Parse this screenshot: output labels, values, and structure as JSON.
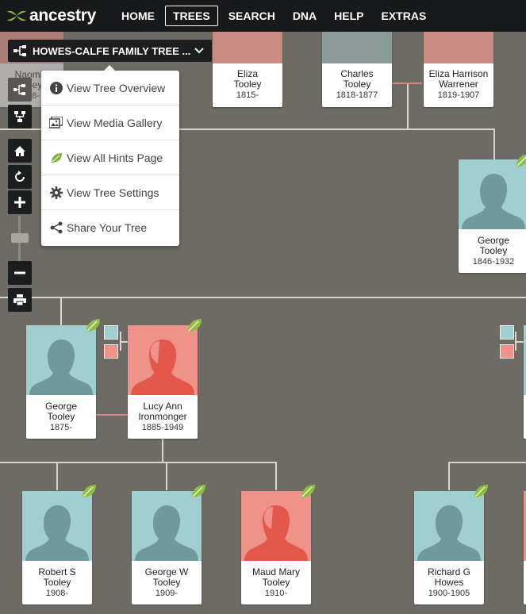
{
  "brand": {
    "name": "ancestry",
    "logo_icon": "leaf-logo-icon"
  },
  "nav": {
    "items": [
      {
        "label": "HOME",
        "active": false
      },
      {
        "label": "TREES",
        "active": true
      },
      {
        "label": "SEARCH",
        "active": false
      },
      {
        "label": "DNA",
        "active": false
      },
      {
        "label": "HELP",
        "active": false
      },
      {
        "label": "EXTRAS",
        "active": false
      }
    ]
  },
  "tree_selector": {
    "label": "HOWES-CALFE FAMILY TREE ...",
    "icon": "family-tree-icon",
    "chevron": "chevron-down-icon"
  },
  "menu": {
    "items": [
      {
        "label": "View Tree Overview",
        "icon": "info-icon"
      },
      {
        "label": "View Media Gallery",
        "icon": "photos-icon"
      },
      {
        "label": "View All Hints Page",
        "icon": "hint-leaf-icon"
      },
      {
        "label": "View Tree Settings",
        "icon": "gear-icon"
      },
      {
        "label": "Share Your Tree",
        "icon": "share-icon"
      }
    ]
  },
  "controls": [
    "pedigree-view-icon",
    "family-view-icon",
    "home-icon",
    "refresh-icon",
    "zoom-in-icon",
    "zoom-out-icon",
    "print-icon"
  ],
  "colors": {
    "male": "#9fcfd0",
    "female": "#ef9289",
    "nav_bg": "#17191a",
    "canvas_bg": "#6e6a64",
    "hint_leaf": "#8fbf3f"
  },
  "people": {
    "naomi": {
      "name1": "Naomi",
      "name2": "Tooley",
      "dates": "1808-"
    },
    "eliza": {
      "name1": "Eliza",
      "name2": "Tooley",
      "dates": "1815-"
    },
    "charles": {
      "name1": "Charles",
      "name2": "Tooley",
      "dates": "1818-1877"
    },
    "eliza_w": {
      "name1": "Eliza Harrison",
      "name2": "Warrener",
      "dates": "1819-1907"
    },
    "george_1846": {
      "name1": "George",
      "name2": "Tooley",
      "dates": "1846-1932"
    },
    "george_1875": {
      "name1": "George",
      "name2": "Tooley",
      "dates": "1875-"
    },
    "lucy": {
      "name1": "Lucy Ann",
      "name2": "Ironmonger",
      "dates": "1885-1949"
    },
    "robert": {
      "name1": "Robert S",
      "name2": "Tooley",
      "dates": "1908-"
    },
    "george_w": {
      "name1": "George W",
      "name2": "Tooley",
      "dates": "1909-"
    },
    "maud": {
      "name1": "Maud Mary",
      "name2": "Tooley",
      "dates": "1910-"
    },
    "richard": {
      "name1": "Richard G",
      "name2": "Howes",
      "dates": "1900-1905"
    }
  }
}
